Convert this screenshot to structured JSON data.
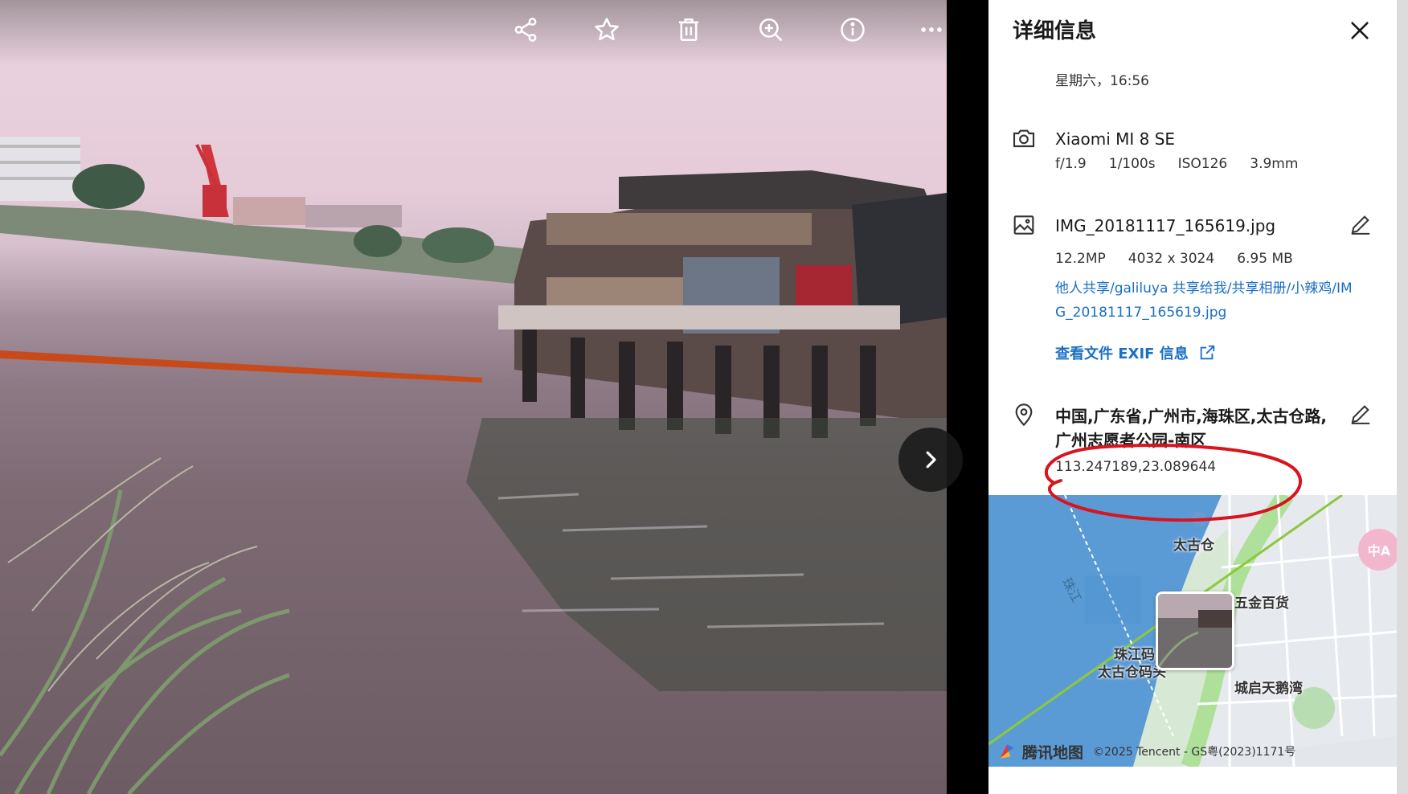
{
  "toolbar": {
    "icons": [
      "share-icon",
      "star-icon",
      "trash-icon",
      "zoom-in-icon",
      "info-icon",
      "more-icon"
    ]
  },
  "panel": {
    "title": "详细信息",
    "date_time": "星期六，16:56",
    "camera": {
      "model": "Xiaomi MI 8 SE",
      "aperture": "f/1.9",
      "shutter": "1/100s",
      "iso": "ISO126",
      "focal": "3.9mm"
    },
    "file": {
      "name": "IMG_20181117_165619.jpg",
      "megapixels": "12.2MP",
      "resolution": "4032 x 3024",
      "size": "6.95 MB",
      "path_line1": "他人共享/galiluya 共享给我/共享相册/小辣鸡/IM",
      "path_line2": "G_20181117_165619.jpg",
      "exif_link": "查看文件 EXIF 信息"
    },
    "location": {
      "address_line1": "中国,广东省,广州市,海珠区,太古仓路,",
      "address_line2": "广州志愿者公园-南区",
      "coordinates": "113.247189,23.089644"
    },
    "map": {
      "labels": [
        "太古仓",
        "五金百货",
        "珠江码",
        "太古仓码头",
        "城启天鹅湾"
      ],
      "river_label": "珠江",
      "brand": "腾讯地图",
      "copyright": "©2025 Tencent - GS粤(2023)1171号",
      "lang_button": "中A"
    }
  },
  "colors": {
    "link": "#1a6fc4",
    "annotation": "#d8141d",
    "river": "#5b9bd5"
  }
}
